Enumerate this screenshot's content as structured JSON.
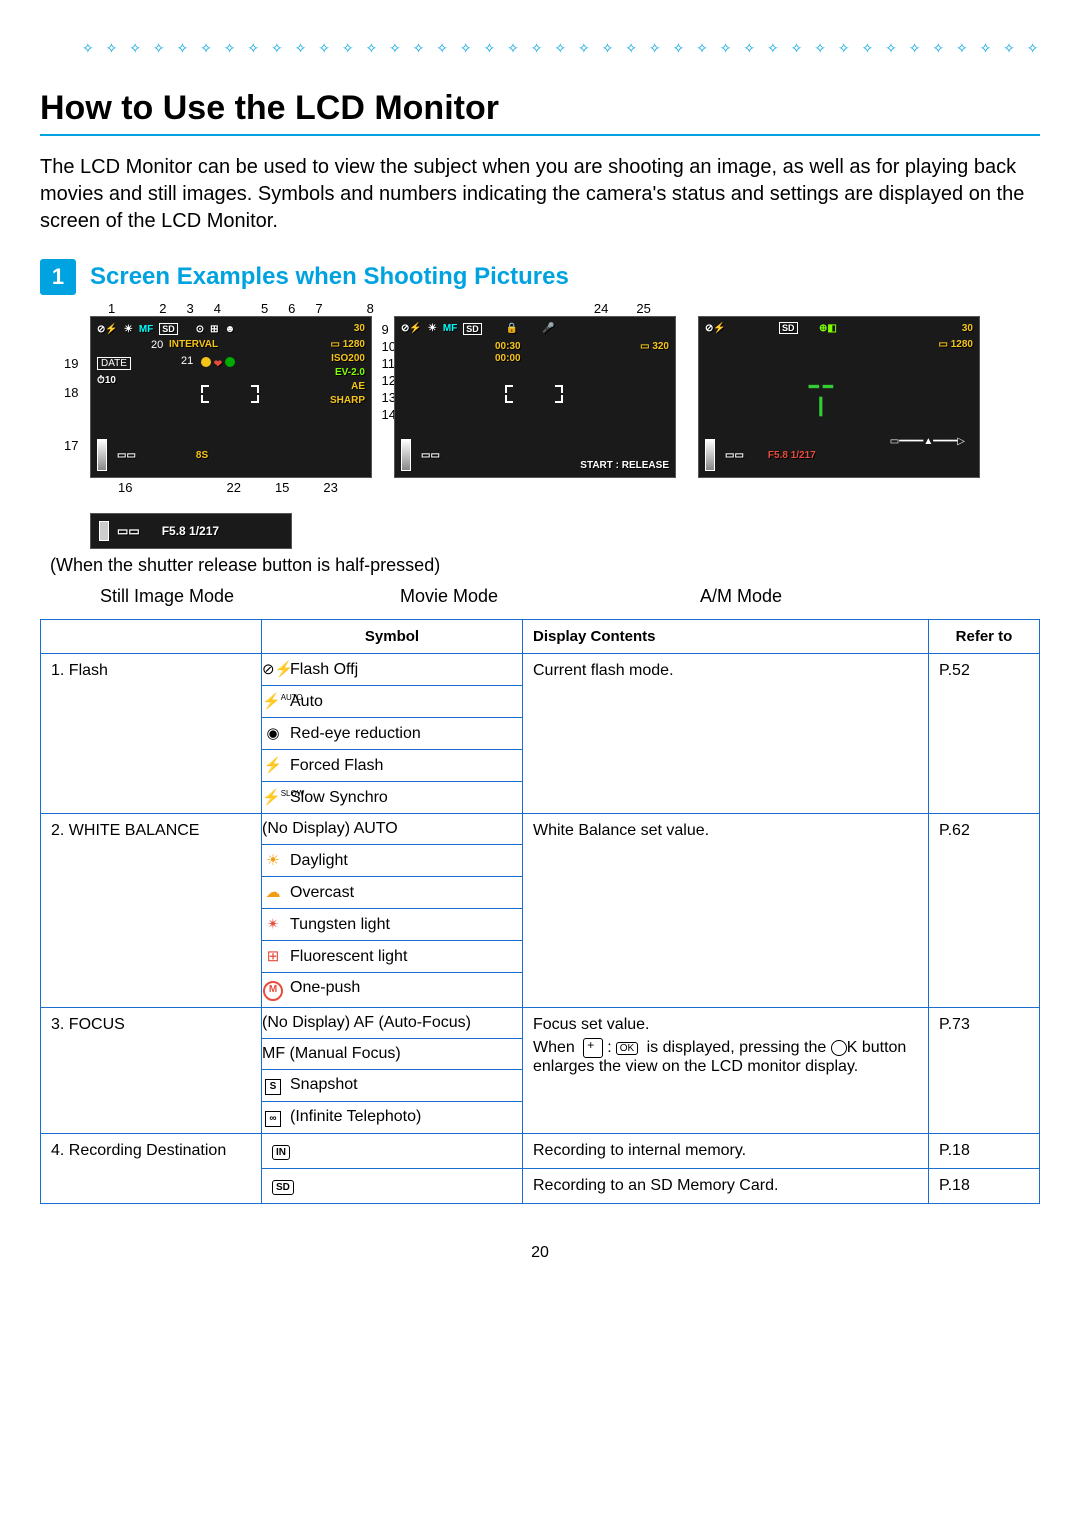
{
  "deco_char": "✧",
  "title": "How to Use the LCD Monitor",
  "intro": "The LCD Monitor can be used to view the subject when you are shooting an image, as well as for playing back movies and still images. Symbols and numbers indicating the camera's status and settings are displayed on the screen of the LCD Monitor.",
  "chapter_num": "1",
  "section_title": "Screen Examples when Shooting Pictures",
  "caption": "(When the shutter release button is half-pressed)",
  "modes": {
    "still": "Still Image Mode",
    "movie": "Movie Mode",
    "am": "A/M Mode"
  },
  "callout_nums_top": [
    "1",
    "2",
    "3",
    "4",
    "5",
    "6",
    "7",
    "8"
  ],
  "callout_nums_left": [
    "19",
    "18",
    "17"
  ],
  "callout_nums_right": [
    "9",
    "10",
    "11",
    "12",
    "13",
    "14"
  ],
  "callout_nums_mid": [
    "20",
    "21",
    "24",
    "25"
  ],
  "callout_nums_bottom": [
    "16",
    "22",
    "15",
    "23"
  ],
  "screen": {
    "remaining": "30",
    "size": "1280",
    "iso": "ISO200",
    "ev": "EV-2.0",
    "ae": "AE",
    "sharp": "SHARP",
    "interval": "INTERVAL",
    "date": "DATE",
    "selftimer": "10",
    "shutter": "8S",
    "movie_remain": "00:30",
    "movie_elapsed": "00:00",
    "movie_size": "320",
    "start_release": "START : RELEASE",
    "half_press": "F5.8 1/217"
  },
  "table": {
    "headers": {
      "col1": "",
      "symbol": "Symbol",
      "display": "Display Contents",
      "refer": "Refer to"
    },
    "rows": [
      {
        "name": "1. Flash",
        "symbols": [
          {
            "icon": "⊘⚡",
            "label": "Flash Offj"
          },
          {
            "icon": "⚡AUTO",
            "label": "Auto"
          },
          {
            "icon": "◉",
            "label": "Red-eye reduction"
          },
          {
            "icon": "⚡",
            "label": "Forced Flash"
          },
          {
            "icon": "⚡SLOW",
            "label": "Slow Synchro"
          }
        ],
        "display": "Current flash mode.",
        "refer": "P.52"
      },
      {
        "name": "2. WHITE BALANCE",
        "symbols": [
          {
            "icon": "",
            "label": "(No Display) AUTO"
          },
          {
            "icon": "sun",
            "label": "Daylight"
          },
          {
            "icon": "cloud",
            "label": "Overcast"
          },
          {
            "icon": "tung",
            "label": "Tungsten light"
          },
          {
            "icon": "fluo",
            "label": "Fluorescent light"
          },
          {
            "icon": "onep",
            "label": "One-push"
          }
        ],
        "display": "White Balance set value.",
        "refer": "P.62"
      },
      {
        "name": "3. FOCUS",
        "symbols": [
          {
            "icon": "",
            "label": "(No Display) AF (Auto-Focus)"
          },
          {
            "icon": "",
            "label": "MF (Manual Focus)"
          },
          {
            "icon": "snap",
            "label": "Snapshot"
          },
          {
            "icon": "inf",
            "label": "(Infinite Telephoto)"
          }
        ],
        "display_lines": [
          "Focus set value.",
          "When ⊕ : OK is displayed, pressing the OK button enlarges the view on the LCD monitor display."
        ],
        "refer": "P.73"
      },
      {
        "name": "4. Recording Destination",
        "dests": [
          {
            "icon": "IN",
            "display": "Recording to internal memory.",
            "refer": "P.18"
          },
          {
            "icon": "SD",
            "display": "Recording to an SD Memory Card.",
            "refer": "P.18"
          }
        ]
      }
    ]
  },
  "page_number": "20"
}
